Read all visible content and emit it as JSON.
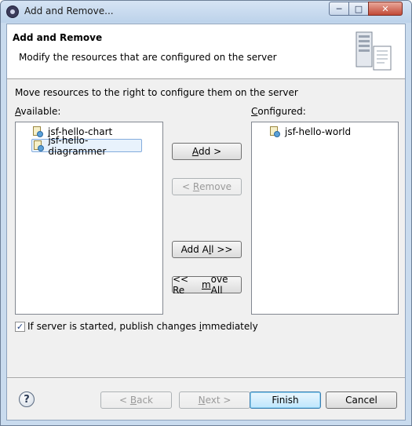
{
  "window": {
    "title": "Add and Remove...",
    "controls": {
      "minimize_icon": "minimize-icon",
      "maximize_icon": "maximize-icon",
      "close_icon": "close-icon"
    }
  },
  "header": {
    "title": "Add and Remove",
    "description": "Modify the resources that are configured on the server"
  },
  "instruction": "Move resources to the right to configure them on the server",
  "available": {
    "label_mnemonic": "A",
    "label_rest": "vailable:",
    "items": [
      {
        "label": "jsf-hello-chart",
        "selected": false
      },
      {
        "label": "jsf-hello-diagrammer",
        "selected": true
      }
    ]
  },
  "configured": {
    "label_mnemonic": "C",
    "label_rest": "onfigured:",
    "items": [
      {
        "label": "jsf-hello-world",
        "selected": false
      }
    ]
  },
  "actions": {
    "add": {
      "pre": "",
      "mnemonic": "A",
      "post": "dd >",
      "enabled": true
    },
    "remove": {
      "pre": "< ",
      "mnemonic": "R",
      "post": "emove",
      "enabled": false
    },
    "add_all": {
      "pre": "Add A",
      "mnemonic": "l",
      "post": "l >>",
      "enabled": true
    },
    "remove_all": {
      "pre": "<< Re",
      "mnemonic": "m",
      "post": "ove All",
      "enabled": true
    }
  },
  "publish": {
    "checked": true,
    "pre": "If server is started, publish changes ",
    "mnemonic": "i",
    "post": "mmediately"
  },
  "footer": {
    "help_glyph": "?",
    "back": {
      "pre": "< ",
      "mnemonic": "B",
      "post": "ack",
      "enabled": false
    },
    "next": {
      "pre": "",
      "mnemonic": "N",
      "post": "ext >",
      "enabled": false
    },
    "finish": {
      "label": "Finish",
      "enabled": true
    },
    "cancel": {
      "label": "Cancel",
      "enabled": true
    }
  },
  "colors": {
    "accent": "#3c7fb1",
    "selection_bg": "#e8f2fc",
    "selection_border": "#84acdd",
    "frame": "#c9dbee"
  }
}
